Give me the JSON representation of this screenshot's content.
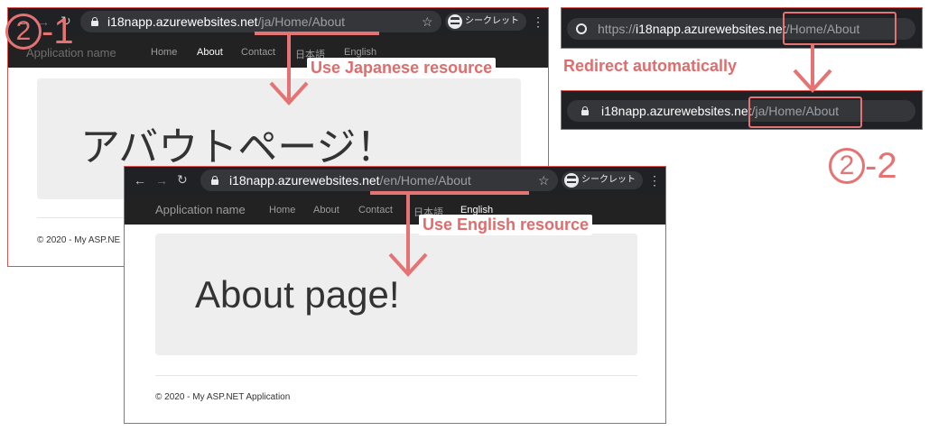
{
  "annotations": {
    "step1": {
      "num": "2",
      "suffix": "-1"
    },
    "step2": {
      "num": "2",
      "suffix": "-2"
    },
    "use_japanese": "Use Japanese resource",
    "use_english": "Use English resource",
    "redirect": "Redirect automatically",
    "accent_color": "#e57373"
  },
  "browser_ja": {
    "url_host": "i18napp.azurewebsites.net",
    "url_path": "/ja/Home/About",
    "incognito_label": "シークレット",
    "nav": {
      "brand": "Application name",
      "items": [
        "Home",
        "About",
        "Contact",
        "日本語",
        "English"
      ],
      "active": "About"
    },
    "heading": "アバウトページ！",
    "footer": "© 2020 - My ASP.NE"
  },
  "browser_en": {
    "url_host": "i18napp.azurewebsites.net",
    "url_path": "/en/Home/About",
    "incognito_label": "シークレット",
    "nav": {
      "brand": "Application name",
      "items": [
        "Home",
        "About",
        "Contact",
        "日本語",
        "English"
      ],
      "active": "English"
    },
    "heading": "About page!",
    "footer": "© 2020 - My ASP.NET Application"
  },
  "address_before": {
    "url_prefix": "https://",
    "url_host": "i18napp.azurewebsites.net",
    "url_path": "/Home/About"
  },
  "address_after": {
    "url_host": "i18napp.azurewebsites.net",
    "url_path": "/ja/Home/About"
  },
  "icons": [
    "back-icon",
    "forward-icon",
    "reload-icon",
    "lock-icon",
    "star-icon",
    "incognito-icon",
    "more-menu-icon",
    "globe-icon"
  ]
}
